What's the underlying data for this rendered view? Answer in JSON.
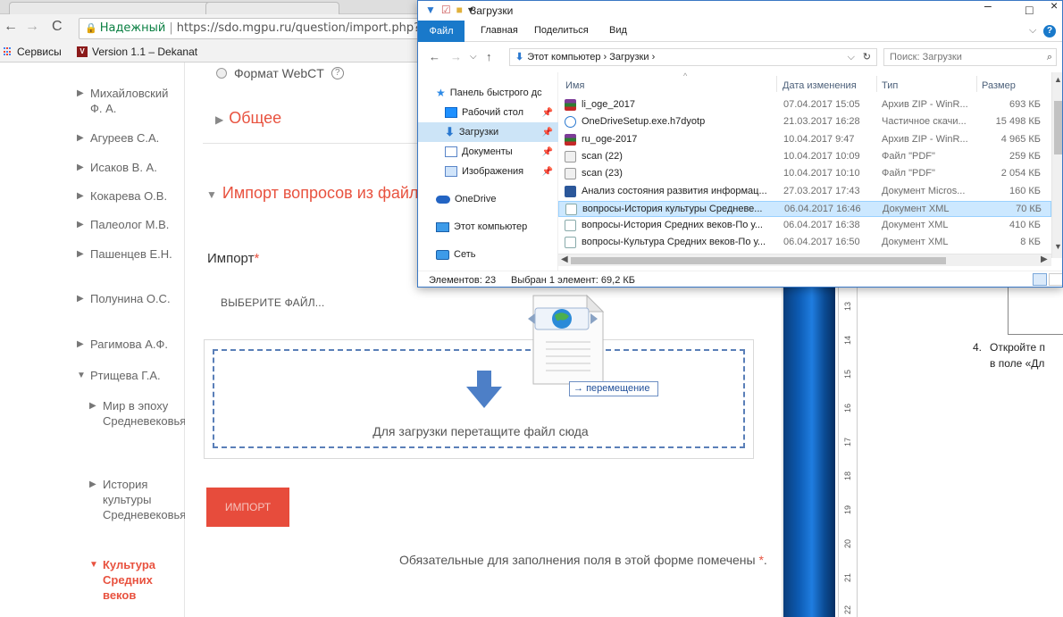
{
  "browser": {
    "secure_label": "Надежный",
    "url": "https://sdo.mgpu.ru/question/import.php?cour",
    "bookmarks": [
      {
        "label": "Сервисы"
      },
      {
        "label": "Version 1.1 – Dekanat"
      }
    ]
  },
  "leftnav": {
    "items": [
      {
        "label": "Михайловский Ф. А.",
        "expanded": false
      },
      {
        "label": "Агуреев С.А.",
        "expanded": false
      },
      {
        "label": "Исаков В. А.",
        "expanded": false
      },
      {
        "label": "Кокарева О.В.",
        "expanded": false
      },
      {
        "label": "Палеолог М.В.",
        "expanded": false
      },
      {
        "label": "Пашенцев Е.Н.",
        "expanded": false
      },
      {
        "label": "Полунина О.С.",
        "expanded": false
      },
      {
        "label": "Рагимова А.Ф.",
        "expanded": false
      },
      {
        "label": "Ртищева Г.А.",
        "expanded": true
      }
    ],
    "subitems": [
      {
        "label": "Мир в эпоху Средневековья",
        "expanded": false,
        "active": false
      },
      {
        "label": "История культуры Средневековья",
        "expanded": false,
        "active": false
      },
      {
        "label": "Культура Средних веков",
        "expanded": true,
        "active": true
      }
    ]
  },
  "main": {
    "format_option": "Формат WebCT",
    "section_general": "Общее",
    "section_import": "Импорт вопросов из файла",
    "import_label": "Импорт",
    "required_mark": "*",
    "choose_file": "ВЫБЕРИТЕ ФАЙЛ...",
    "dropzone_text": "Для загрузки перетащите файл сюда",
    "import_button": "ИМПОРТ",
    "required_note": "Обязательные для заполнения поля в этой форме помечены",
    "drag_tooltip": "перемещение"
  },
  "explorer": {
    "title": "Загрузки",
    "ribbon_tabs": [
      "Файл",
      "Главная",
      "Поделиться",
      "Вид"
    ],
    "path": "Этот компьютер › Загрузки ›",
    "search_placeholder": "Поиск: Загрузки",
    "nav": [
      {
        "label": "Панель быстрого дс",
        "icon": "star-icon",
        "pinned": false,
        "selected": false
      },
      {
        "label": "Рабочий стол",
        "icon": "desktop-icon",
        "pinned": true,
        "selected": false
      },
      {
        "label": "Загрузки",
        "icon": "downloads-icon",
        "pinned": true,
        "selected": true
      },
      {
        "label": "Документы",
        "icon": "documents-icon",
        "pinned": true,
        "selected": false
      },
      {
        "label": "Изображения",
        "icon": "pictures-icon",
        "pinned": true,
        "selected": false
      },
      {
        "label": "OneDrive",
        "icon": "onedrive-icon",
        "pinned": false,
        "selected": false
      },
      {
        "label": "Этот компьютер",
        "icon": "computer-icon",
        "pinned": false,
        "selected": false
      },
      {
        "label": "Сеть",
        "icon": "network-icon",
        "pinned": false,
        "selected": false
      }
    ],
    "columns": [
      "Имя",
      "Дата изменения",
      "Тип",
      "Размер"
    ],
    "files": [
      {
        "name": "li_oge_2017",
        "date": "07.04.2017 15:05",
        "type": "Архив ZIP - WinR...",
        "size": "693 КБ",
        "icon": "zip",
        "selected": false
      },
      {
        "name": "OneDriveSetup.exe.h7dyotp",
        "date": "21.03.2017 16:28",
        "type": "Частичное скачи...",
        "size": "15 498 КБ",
        "icon": "exe",
        "selected": false
      },
      {
        "name": "ru_oge-2017",
        "date": "10.04.2017 9:47",
        "type": "Архив ZIP - WinR...",
        "size": "4 965 КБ",
        "icon": "zip",
        "selected": false
      },
      {
        "name": "scan (22)",
        "date": "10.04.2017 10:09",
        "type": "Файл \"PDF\"",
        "size": "259 КБ",
        "icon": "pdf",
        "selected": false
      },
      {
        "name": "scan (23)",
        "date": "10.04.2017 10:10",
        "type": "Файл \"PDF\"",
        "size": "2 054 КБ",
        "icon": "pdf",
        "selected": false
      },
      {
        "name": "Анализ состояния развития информац...",
        "date": "27.03.2017 17:43",
        "type": "Документ Micros...",
        "size": "160 КБ",
        "icon": "word",
        "selected": false
      },
      {
        "name": "вопросы-История  культуры Средневе...",
        "date": "06.04.2017 16:46",
        "type": "Документ XML",
        "size": "70 КБ",
        "icon": "xml",
        "selected": true
      },
      {
        "name": "вопросы-История Средних веков-По у...",
        "date": "06.04.2017 16:38",
        "type": "Документ XML",
        "size": "410 КБ",
        "icon": "xml",
        "selected": false
      },
      {
        "name": "вопросы-Культура Средних веков-По у...",
        "date": "06.04.2017 16:50",
        "type": "Документ XML",
        "size": "8 КБ",
        "icon": "xml",
        "selected": false
      }
    ],
    "status_count": "Элементов: 23",
    "status_selected": "Выбран 1 элемент: 69,2 КБ"
  },
  "document": {
    "list_number": "4.",
    "line1": "Откройте п",
    "line2": "в поле «Дл",
    "ruler_marks": [
      "13",
      "14",
      "15",
      "16",
      "17",
      "18",
      "19",
      "20",
      "21",
      "22"
    ]
  },
  "colors": {
    "accent_red": "#e8523f",
    "button_red": "#e74c3c",
    "explorer_blue": "#1979ca",
    "selection_blue": "#cce8ff"
  }
}
